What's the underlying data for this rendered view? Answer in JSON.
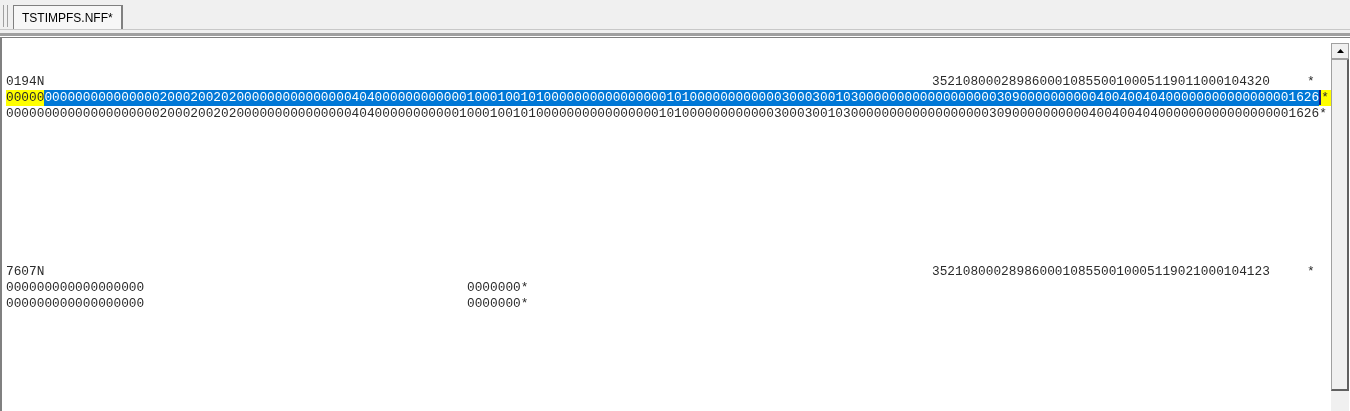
{
  "tabs": [
    {
      "label": "TSTIMPFS.NFF*",
      "selected": true
    }
  ],
  "records": [
    {
      "lines": [
        {
          "kind": "header",
          "id": "0194N",
          "reference": "35210800028986000108550010005119011000104320",
          "end": "*"
        },
        {
          "kind": "detail",
          "current": true,
          "parts": [
            {
              "text": "00000",
              "selected": false
            },
            {
              "text": "0000000000000002000200202000000000000000404000000000000100010010100000000000000001010000000000003000300103000000000000000000309000000000040040040400000000000000001626",
              "selected": true
            }
          ],
          "end": "*"
        },
        {
          "kind": "detail",
          "current": false,
          "parts": [
            {
              "text": "000000000000000000002000200202000000000000000404000000000001000100101000000000000000010100000000000030003001030000000000000000003090000000000400400404000000000000000001626",
              "selected": false
            }
          ],
          "end": "*"
        }
      ]
    },
    {
      "lines": [
        {
          "kind": "header",
          "id": "7607N",
          "reference": "35210800028986000108550010005119021000104123",
          "end": "*"
        },
        {
          "kind": "short",
          "text": "000000000000000000",
          "end": "0000000*"
        },
        {
          "kind": "short",
          "text": "000000000000000000",
          "end": "0000000*"
        }
      ]
    }
  ]
}
